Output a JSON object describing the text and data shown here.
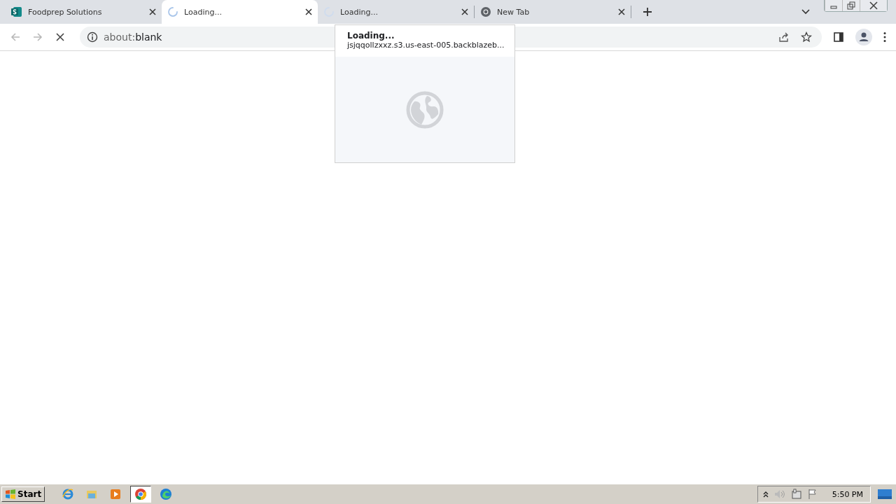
{
  "tabs": [
    {
      "kind": "sway",
      "title": "Foodprep Solutions",
      "selected": false
    },
    {
      "kind": "spinner",
      "title": "Loading...",
      "selected": true
    },
    {
      "kind": "spinner",
      "title": "Loading...",
      "selected": false
    },
    {
      "kind": "chrome",
      "title": "New Tab",
      "selected": false
    }
  ],
  "toolbar": {
    "back_disabled": true,
    "forward_disabled": true,
    "loading": true
  },
  "address": {
    "scheme": "about:",
    "path": "blank"
  },
  "hover_card": {
    "title": "Loading...",
    "url": "jsjqqollzxxz.s3.us-east-005.backblazeb..."
  },
  "taskbar": {
    "start": "Start",
    "apps": [
      {
        "kind": "ie",
        "selected": false
      },
      {
        "kind": "folder",
        "selected": false
      },
      {
        "kind": "media",
        "selected": false
      },
      {
        "kind": "chrome",
        "selected": true
      },
      {
        "kind": "edge",
        "selected": false
      }
    ],
    "clock": "5:50 PM"
  }
}
